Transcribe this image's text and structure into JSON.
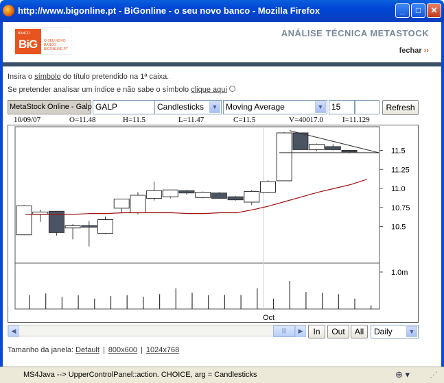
{
  "window": {
    "title": "http://www.bigonline.pt - BiGonline - o seu novo banco - Mozilla Firefox",
    "minimize": "_",
    "maximize": "□",
    "close": "✕"
  },
  "header": {
    "logo_small": "BANCO",
    "logo_main": "BiG",
    "logo_sub": "O SEU NOVO BANCO BIGONLINE.PT",
    "title": "ANÁLISE TÉCNICA METASTOCK",
    "fechar": "fechar",
    "fechar_arrows": "››"
  },
  "instructions": {
    "line1_a": "Insira o ",
    "line1_link": "símbolo",
    "line1_b": " do título pretendido na 1ª caixa.",
    "line2_a": "Se pretender analisar um índice e não sabe o símbolo ",
    "line2_link": "clique aqui"
  },
  "controls": {
    "label": "MetaStock Online - Galp",
    "symbol": "GALP",
    "chart_type": "Candlesticks",
    "indicator": "Moving Average",
    "period": "15",
    "extra": "",
    "refresh": "Refresh"
  },
  "infobar": {
    "date": "10/09/07",
    "open": "O=11.48",
    "high": "H=11.5",
    "low": "L=11.47",
    "close": "C=11.5",
    "volume": "V=40017.0",
    "indicator": "I=11.129"
  },
  "chart_data": {
    "type": "candlestick",
    "y_ticks": [
      "11.5",
      "11.25",
      "11.0",
      "10.75",
      "10.5"
    ],
    "volume_tick": "1.0m",
    "x_label": "Oct",
    "candles": [
      {
        "open": 10.39,
        "high": 10.78,
        "low": 10.39,
        "close": 10.77
      },
      {
        "open": 10.66,
        "high": 10.72,
        "low": 10.56,
        "close": 10.69
      },
      {
        "open": 10.7,
        "high": 10.7,
        "low": 10.38,
        "close": 10.42
      },
      {
        "open": 10.48,
        "high": 10.53,
        "low": 10.33,
        "close": 10.51
      },
      {
        "open": 10.51,
        "high": 10.57,
        "low": 10.24,
        "close": 10.49
      },
      {
        "open": 10.41,
        "high": 10.63,
        "low": 10.4,
        "close": 10.59
      },
      {
        "open": 10.74,
        "high": 10.74,
        "low": 10.68,
        "close": 10.86
      },
      {
        "open": 10.68,
        "high": 10.95,
        "low": 10.66,
        "close": 10.91
      },
      {
        "open": 10.87,
        "high": 11.09,
        "low": 10.84,
        "close": 10.97
      },
      {
        "open": 10.89,
        "high": 10.95,
        "low": 10.87,
        "close": 10.98
      },
      {
        "open": 10.97,
        "high": 10.98,
        "low": 10.92,
        "close": 10.94
      },
      {
        "open": 10.88,
        "high": 10.96,
        "low": 10.87,
        "close": 10.95
      },
      {
        "open": 10.94,
        "high": 10.95,
        "low": 10.87,
        "close": 10.87
      },
      {
        "open": 10.89,
        "high": 10.9,
        "low": 10.84,
        "close": 10.85
      },
      {
        "open": 10.82,
        "high": 10.98,
        "low": 10.78,
        "close": 10.96
      },
      {
        "open": 10.95,
        "high": 11.11,
        "low": 10.94,
        "close": 11.09
      },
      {
        "open": 11.1,
        "high": 11.74,
        "low": 11.1,
        "close": 11.73
      },
      {
        "open": 11.73,
        "high": 11.73,
        "low": 11.51,
        "close": 11.51
      },
      {
        "open": 11.51,
        "high": 11.59,
        "low": 11.49,
        "close": 11.58
      },
      {
        "open": 11.55,
        "high": 11.58,
        "low": 11.5,
        "close": 11.51
      },
      {
        "open": 11.5,
        "high": 11.5,
        "low": 11.47,
        "close": 11.48
      }
    ],
    "moving_average": [
      10.66,
      10.66,
      10.66,
      10.66,
      10.67,
      10.67,
      10.68,
      10.68,
      10.68,
      10.68,
      10.67,
      10.67,
      10.68,
      10.68,
      10.72,
      10.77,
      10.83,
      10.89,
      10.95,
      11.0,
      11.05,
      11.12
    ],
    "volume": [
      0.37,
      0.42,
      0.33,
      0.37,
      0.28,
      0.35,
      0.37,
      0.33,
      0.4,
      0.56,
      0.44,
      0.37,
      0.38,
      0.38,
      0.56,
      0.28,
      0.76,
      0.46,
      0.44,
      0.4,
      0.28,
      0.1
    ]
  },
  "bottom": {
    "scroll_left": "◀",
    "scroll_right": "▶",
    "thumb": "|||",
    "zoom_in": "In",
    "zoom_out": "Out",
    "all": "All",
    "interval": "Daily"
  },
  "window_size": {
    "label": "Tamanho da janela: ",
    "default": "Default",
    "sep": "|",
    "size1": "800x600",
    "size2": "1024x768"
  },
  "status": {
    "message": "MS4Java --> UpperControlPanel::action. CHOICE, arg = Candlesticks"
  }
}
